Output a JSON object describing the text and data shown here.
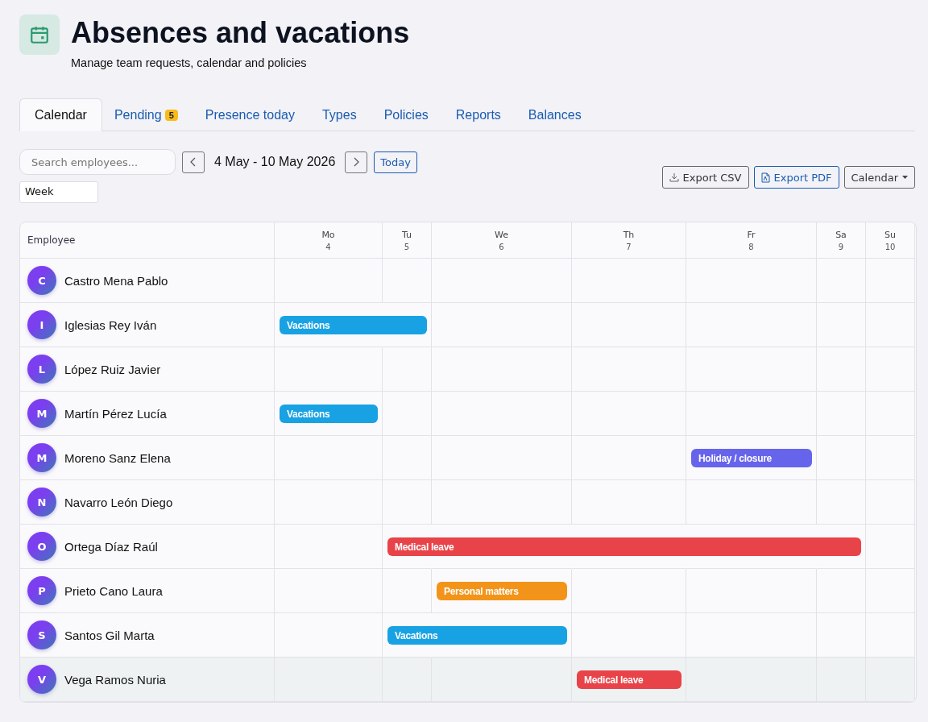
{
  "header": {
    "title": "Absences and vacations",
    "subtitle": "Manage team requests, calendar and policies"
  },
  "tabs": [
    {
      "label": "Calendar",
      "selected": true
    },
    {
      "label": "Pending",
      "badge": "5",
      "selected": false
    },
    {
      "label": "Presence today",
      "selected": false
    },
    {
      "label": "Types",
      "selected": false
    },
    {
      "label": "Policies",
      "selected": false
    },
    {
      "label": "Reports",
      "selected": false
    },
    {
      "label": "Balances",
      "selected": false
    }
  ],
  "toolbar": {
    "search": {
      "placeholder": "Search employees..."
    },
    "range": "4 May - 10 May 2026",
    "today_button": "Today",
    "view": "Week",
    "export_csv": "Export CSV",
    "export_pdf": "Export PDF",
    "mode_dropdown": "Calendar"
  },
  "calendar": {
    "employee_column": "Employee",
    "days": [
      {
        "name": "Mo",
        "date": "4"
      },
      {
        "name": "Tu",
        "date": "5"
      },
      {
        "name": "We",
        "date": "6"
      },
      {
        "name": "Th",
        "date": "7"
      },
      {
        "name": "Fr",
        "date": "8"
      },
      {
        "name": "Sa",
        "date": "9"
      },
      {
        "name": "Su",
        "date": "10"
      }
    ],
    "rows": [
      {
        "initial": "C",
        "name": "Castro Mena Pablo",
        "highlighted": false
      },
      {
        "initial": "I",
        "name": "Iglesias Rey Iván",
        "highlighted": false,
        "absence": {
          "label": "Vacations",
          "color": "#18a2e3",
          "days": [
            true,
            true,
            false,
            false,
            false,
            false,
            false
          ]
        }
      },
      {
        "initial": "L",
        "name": "López Ruiz Javier",
        "highlighted": false
      },
      {
        "initial": "M",
        "name": "Martín Pérez Lucía",
        "highlighted": false,
        "absence": {
          "label": "Vacations",
          "color": "#18a2e3",
          "days": [
            true,
            false,
            false,
            false,
            false,
            false,
            false
          ]
        }
      },
      {
        "initial": "M",
        "name": "Moreno Sanz Elena",
        "highlighted": false,
        "absence": {
          "label": "Holiday / closure",
          "color": "#6764ec",
          "days": [
            false,
            false,
            false,
            false,
            true,
            false,
            false
          ]
        }
      },
      {
        "initial": "N",
        "name": "Navarro León Diego",
        "highlighted": false
      },
      {
        "initial": "O",
        "name": "Ortega Díaz Raúl",
        "highlighted": false,
        "absence": {
          "label": "Medical leave",
          "color": "#e84349",
          "days": [
            false,
            true,
            true,
            true,
            true,
            true,
            false
          ]
        }
      },
      {
        "initial": "P",
        "name": "Prieto Cano Laura",
        "highlighted": false,
        "absence": {
          "label": "Personal matters",
          "color": "#f29419",
          "days": [
            false,
            false,
            true,
            false,
            false,
            false,
            false
          ]
        }
      },
      {
        "initial": "S",
        "name": "Santos Gil Marta",
        "highlighted": false,
        "absence": {
          "label": "Vacations",
          "color": "#18a2e3",
          "days": [
            false,
            true,
            true,
            false,
            false,
            false,
            false
          ]
        }
      },
      {
        "initial": "V",
        "name": "Vega Ramos Nuria",
        "highlighted": true,
        "absence": {
          "label": "Medical leave",
          "color": "#e84349",
          "days": [
            false,
            false,
            false,
            true,
            false,
            false,
            false
          ]
        }
      }
    ]
  }
}
